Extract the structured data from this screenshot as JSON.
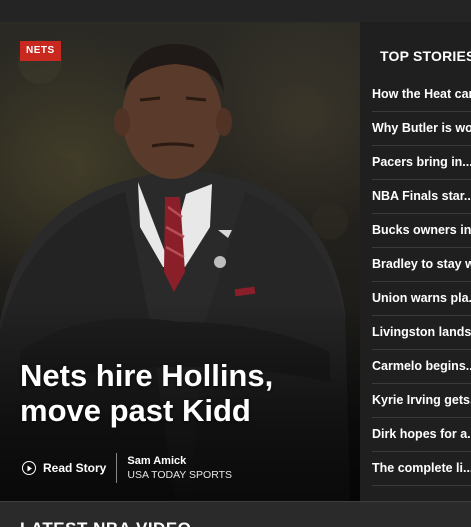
{
  "hero": {
    "tag": "NETS",
    "headline_line1": "Nets hire Hollins,",
    "headline_line2": "move past Kidd",
    "read_story_label": "Read Story",
    "author": "Sam Amick",
    "organization": "USA TODAY SPORTS"
  },
  "sidebar": {
    "title": "TOP STORIES",
    "items": [
      {
        "label": "How the Heat can..."
      },
      {
        "label": "Why Butler is wo..."
      },
      {
        "label": "Pacers bring in..."
      },
      {
        "label": "NBA Finals star..."
      },
      {
        "label": "Bucks owners in..."
      },
      {
        "label": "Bradley to stay w..."
      },
      {
        "label": "Union warns pla..."
      },
      {
        "label": "Livingston lands..."
      },
      {
        "label": "Carmelo begins..."
      },
      {
        "label": "Kyrie Irving gets..."
      },
      {
        "label": "Dirk hopes for a..."
      },
      {
        "label": "The complete li..."
      }
    ]
  },
  "footer": {
    "title": "LATEST NBA VIDEO"
  },
  "icons": {
    "read_story": "play-circle-icon"
  },
  "colors": {
    "tag_background": "#c8281e",
    "page_background": "#1a1a1a",
    "sidebar_background": "#1f1f1f"
  }
}
